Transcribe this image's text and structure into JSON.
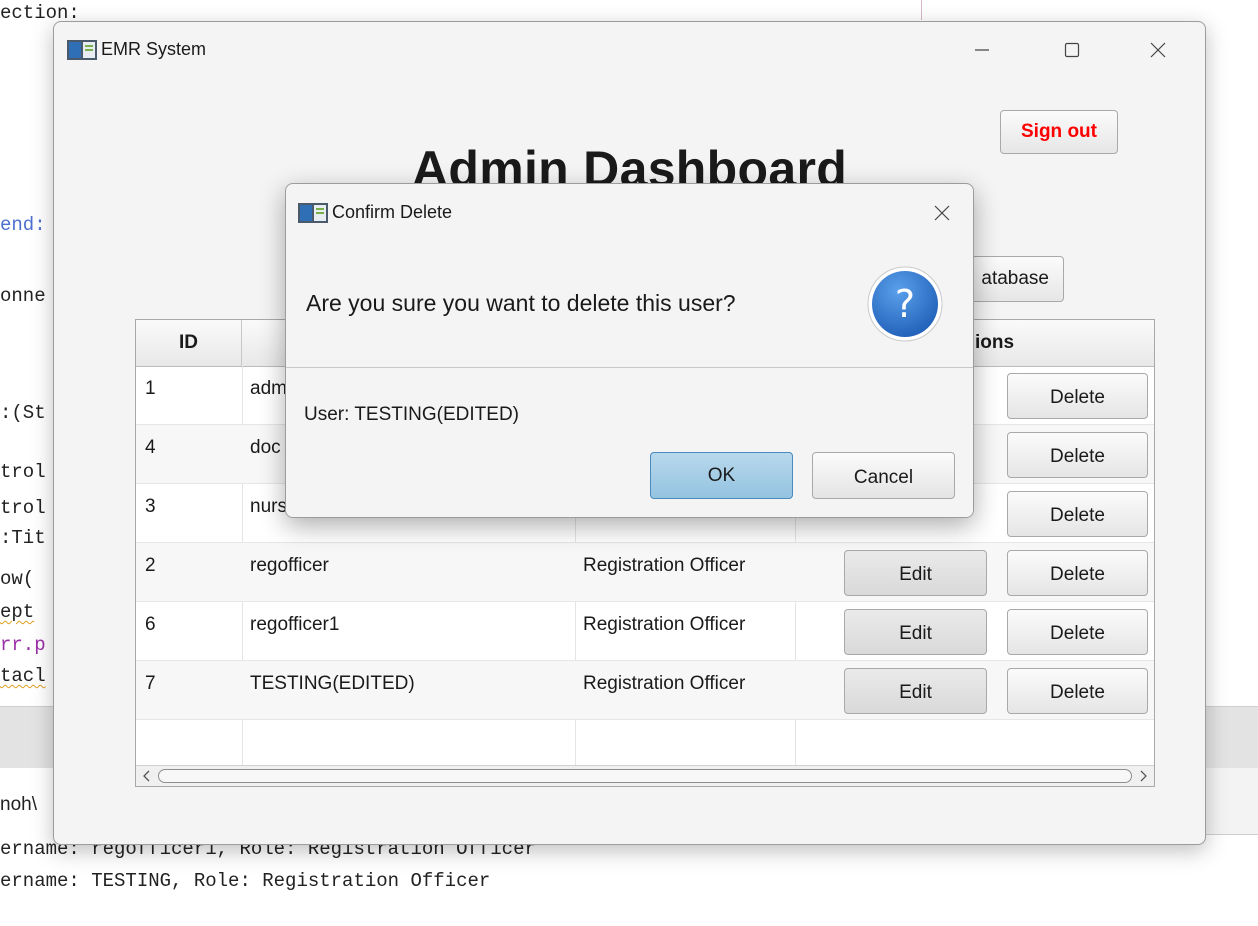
{
  "ide": {
    "code_lines": [
      {
        "text": "ection:",
        "style": ""
      },
      {
        "text": "end:",
        "style": "blue"
      },
      {
        "text": "onne",
        "style": ""
      },
      {
        "text": ":(St",
        "style": ""
      },
      {
        "text": "trol",
        "style": ""
      },
      {
        "text": "trol",
        "style": ""
      },
      {
        "text": ":Tit",
        "style": ""
      },
      {
        "text": "ow(",
        "style": ""
      },
      {
        "text": "ept",
        "style": "squiggle"
      },
      {
        "text": "rr.p",
        "style": "purple"
      },
      {
        "text": "tacl",
        "style": "squiggle"
      }
    ],
    "path_fragment": "noh\\",
    "output_lines": [
      "ername: regofficer1, Role: Registration Officer",
      "ername: TESTING, Role: Registration Officer"
    ]
  },
  "app": {
    "title": "EMR System",
    "dashboard_title": "Admin Dashboard",
    "signout_label": "Sign out",
    "db_button_label": "atabase",
    "table": {
      "headers": {
        "id": "ID",
        "actions": "ions"
      },
      "rows": [
        {
          "id": "1",
          "username": "adm",
          "role": "",
          "edit": "",
          "delete": "Delete"
        },
        {
          "id": "4",
          "username": "doc",
          "role": "",
          "edit": "",
          "delete": "Delete"
        },
        {
          "id": "3",
          "username": "nurs",
          "role": "",
          "edit": "",
          "delete": "Delete"
        },
        {
          "id": "2",
          "username": "regofficer",
          "role": "Registration Officer",
          "edit": "Edit",
          "delete": "Delete"
        },
        {
          "id": "6",
          "username": "regofficer1",
          "role": "Registration Officer",
          "edit": "Edit",
          "delete": "Delete"
        },
        {
          "id": "7",
          "username": "TESTING(EDITED)",
          "role": "Registration Officer",
          "edit": "Edit",
          "delete": "Delete"
        }
      ]
    }
  },
  "dialog": {
    "title": "Confirm Delete",
    "question": "Are you sure you want to delete this user?",
    "content": "User: TESTING(EDITED)",
    "ok_label": "OK",
    "cancel_label": "Cancel",
    "icon": "question-icon"
  },
  "colors": {
    "signout_text": "#ff0000",
    "ok_button": "#a6cde6",
    "question_icon": "#2b6fc7"
  }
}
